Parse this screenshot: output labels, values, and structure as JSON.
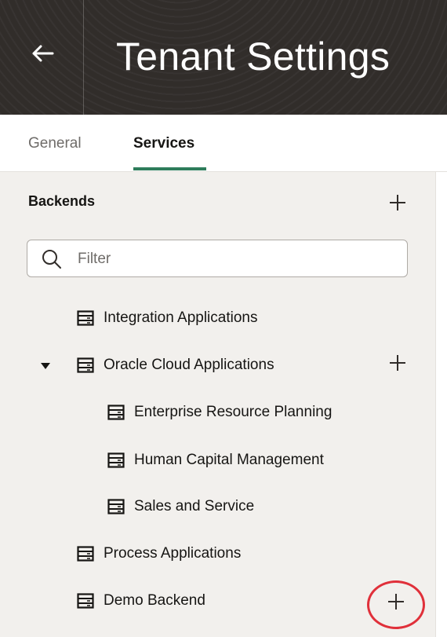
{
  "header": {
    "title": "Tenant Settings",
    "back_icon": "arrow-left-icon"
  },
  "tabs": [
    {
      "label": "General",
      "selected": false
    },
    {
      "label": "Services",
      "selected": true
    }
  ],
  "backends": {
    "section_title": "Backends",
    "add_icon": "plus-icon",
    "filter": {
      "placeholder": "Filter",
      "value": ""
    },
    "items": [
      {
        "label": "Integration Applications",
        "level": 0,
        "icon": "server-icon"
      },
      {
        "label": "Oracle Cloud Applications",
        "level": 0,
        "icon": "server-icon",
        "expanded": true,
        "has_add": true
      },
      {
        "label": "Enterprise Resource Planning",
        "level": 1,
        "icon": "server-icon"
      },
      {
        "label": "Human Capital Management",
        "level": 1,
        "icon": "server-icon"
      },
      {
        "label": "Sales and Service",
        "level": 1,
        "icon": "server-icon"
      },
      {
        "label": "Process Applications",
        "level": 0,
        "icon": "server-icon"
      },
      {
        "label": "Demo Backend",
        "level": 0,
        "icon": "server-icon",
        "has_add": true,
        "highlighted": true
      }
    ]
  },
  "colors": {
    "header_bg": "#312d2a",
    "tab_accent": "#2e7d5b",
    "sidebar_bg": "#f2f0ed",
    "highlight_ring": "#e0303a"
  }
}
